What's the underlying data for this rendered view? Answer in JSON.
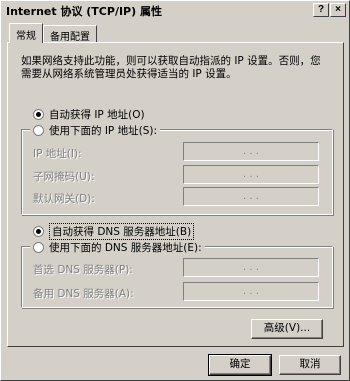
{
  "window": {
    "title": "Internet 协议 (TCP/IP) 属性"
  },
  "titlebar_buttons": {
    "help": "?",
    "close": "×"
  },
  "tabs": [
    {
      "label": "常规"
    },
    {
      "label": "备用配置"
    }
  ],
  "description": "如果网络支持此功能，则可以获取自动指派的 IP 设置。否则，您需要从网络系统管理员处获得适当的 IP 设置。",
  "ip": {
    "auto_label": "自动获得 IP 地址(O)",
    "manual_label": "使用下面的 IP 地址(S):",
    "fields": [
      {
        "label": "IP 地址(I):",
        "value": ".   .   ."
      },
      {
        "label": "子网掩码(U):",
        "value": ".   .   ."
      },
      {
        "label": "默认网关(D):",
        "value": ".   .   ."
      }
    ]
  },
  "dns": {
    "auto_label": "自动获得 DNS 服务器地址(B)",
    "manual_label": "使用下面的 DNS 服务器地址(E):",
    "fields": [
      {
        "label": "首选 DNS 服务器(P):",
        "value": ".   .   ."
      },
      {
        "label": "备用 DNS 服务器(A):",
        "value": ".   .   ."
      }
    ]
  },
  "buttons": {
    "advanced": "高级(V)...",
    "ok": "确定",
    "cancel": "取消"
  }
}
